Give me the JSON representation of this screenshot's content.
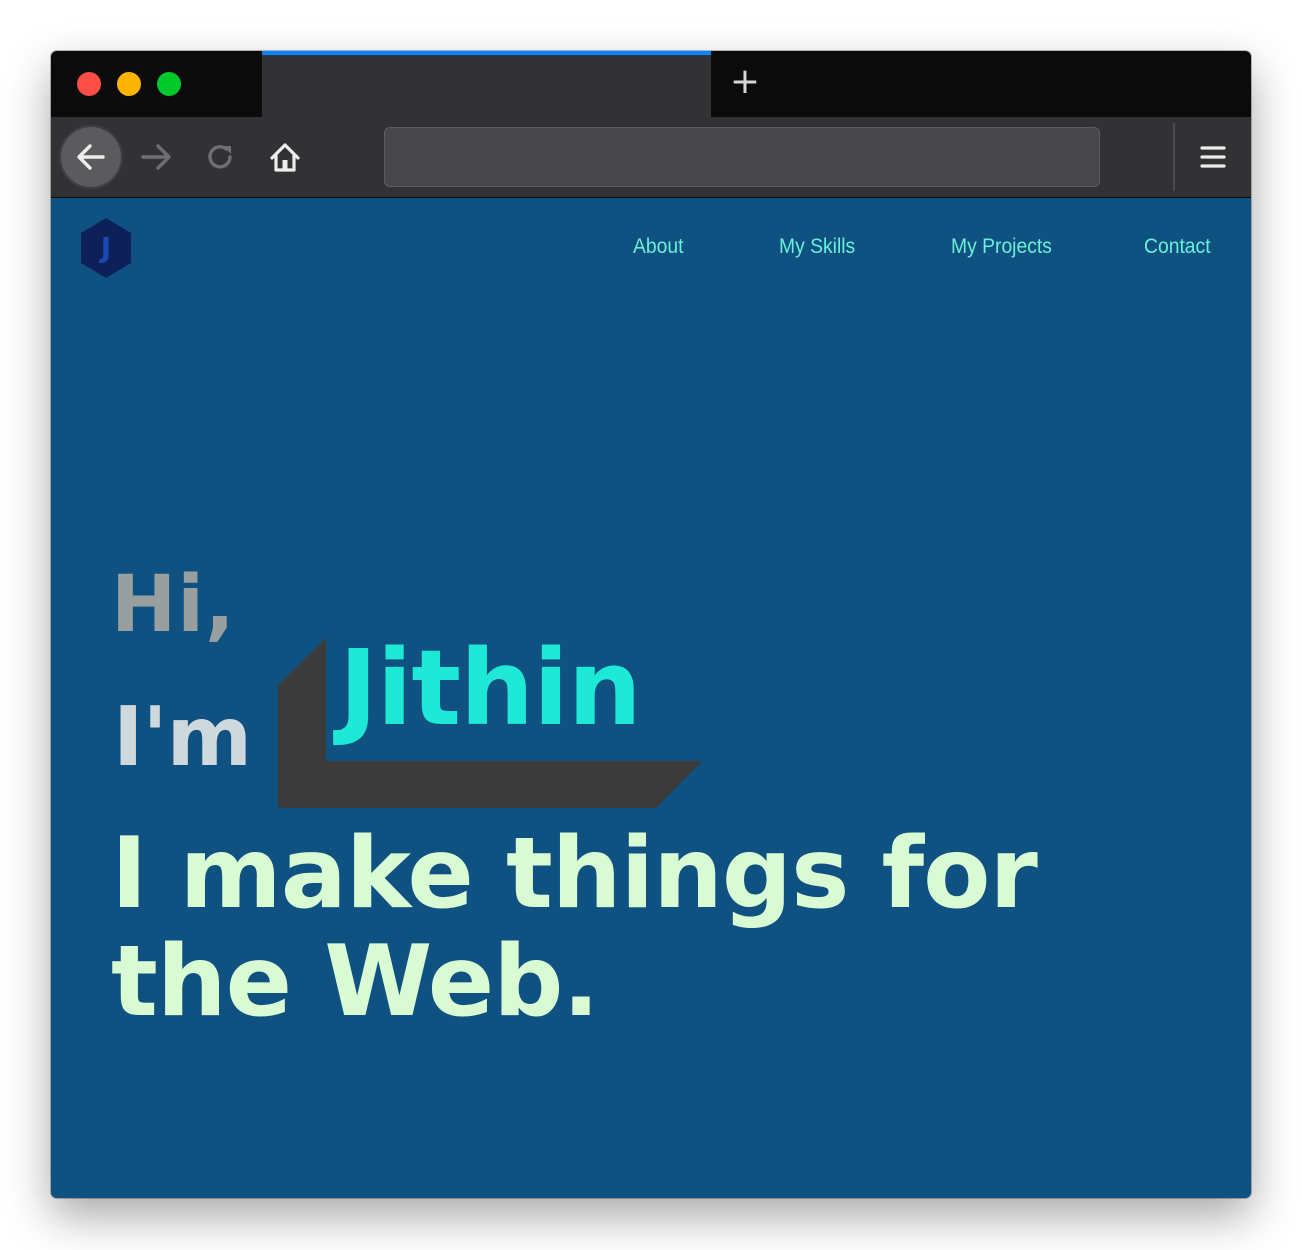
{
  "browser": {
    "tab": {
      "title": ""
    },
    "new_tab_label": "+",
    "url": {
      "value": "",
      "placeholder": ""
    },
    "icons": {
      "back": "arrow-left-icon",
      "forward": "arrow-right-icon",
      "reload": "reload-icon",
      "home": "home-icon",
      "menu": "hamburger-menu-icon"
    },
    "colors": {
      "tab_accent": "#0a84ff",
      "traffic_red": "#fd4d47",
      "traffic_yellow": "#fdb400",
      "traffic_green": "#00c92c"
    }
  },
  "site": {
    "logo_letter": "J",
    "nav": [
      {
        "label": "About"
      },
      {
        "label": "My Skills"
      },
      {
        "label": "My Projects"
      },
      {
        "label": "Contact"
      }
    ],
    "hero": {
      "greeting": "Hi,",
      "intro": "I'm",
      "name": "Jithin",
      "tagline_line1": "I make things for",
      "tagline_line2": "the Web."
    },
    "colors": {
      "background": "#0f5180",
      "nav_link": "#69f0d6",
      "greeting": "#979f9f",
      "intro": "#cfd8dc",
      "name": "#1de9d6",
      "tagline": "#d9fbd3",
      "name_decoration": "#3b3b3b",
      "logo_fill": "#0d2158",
      "logo_letter": "#1a48b4"
    }
  }
}
